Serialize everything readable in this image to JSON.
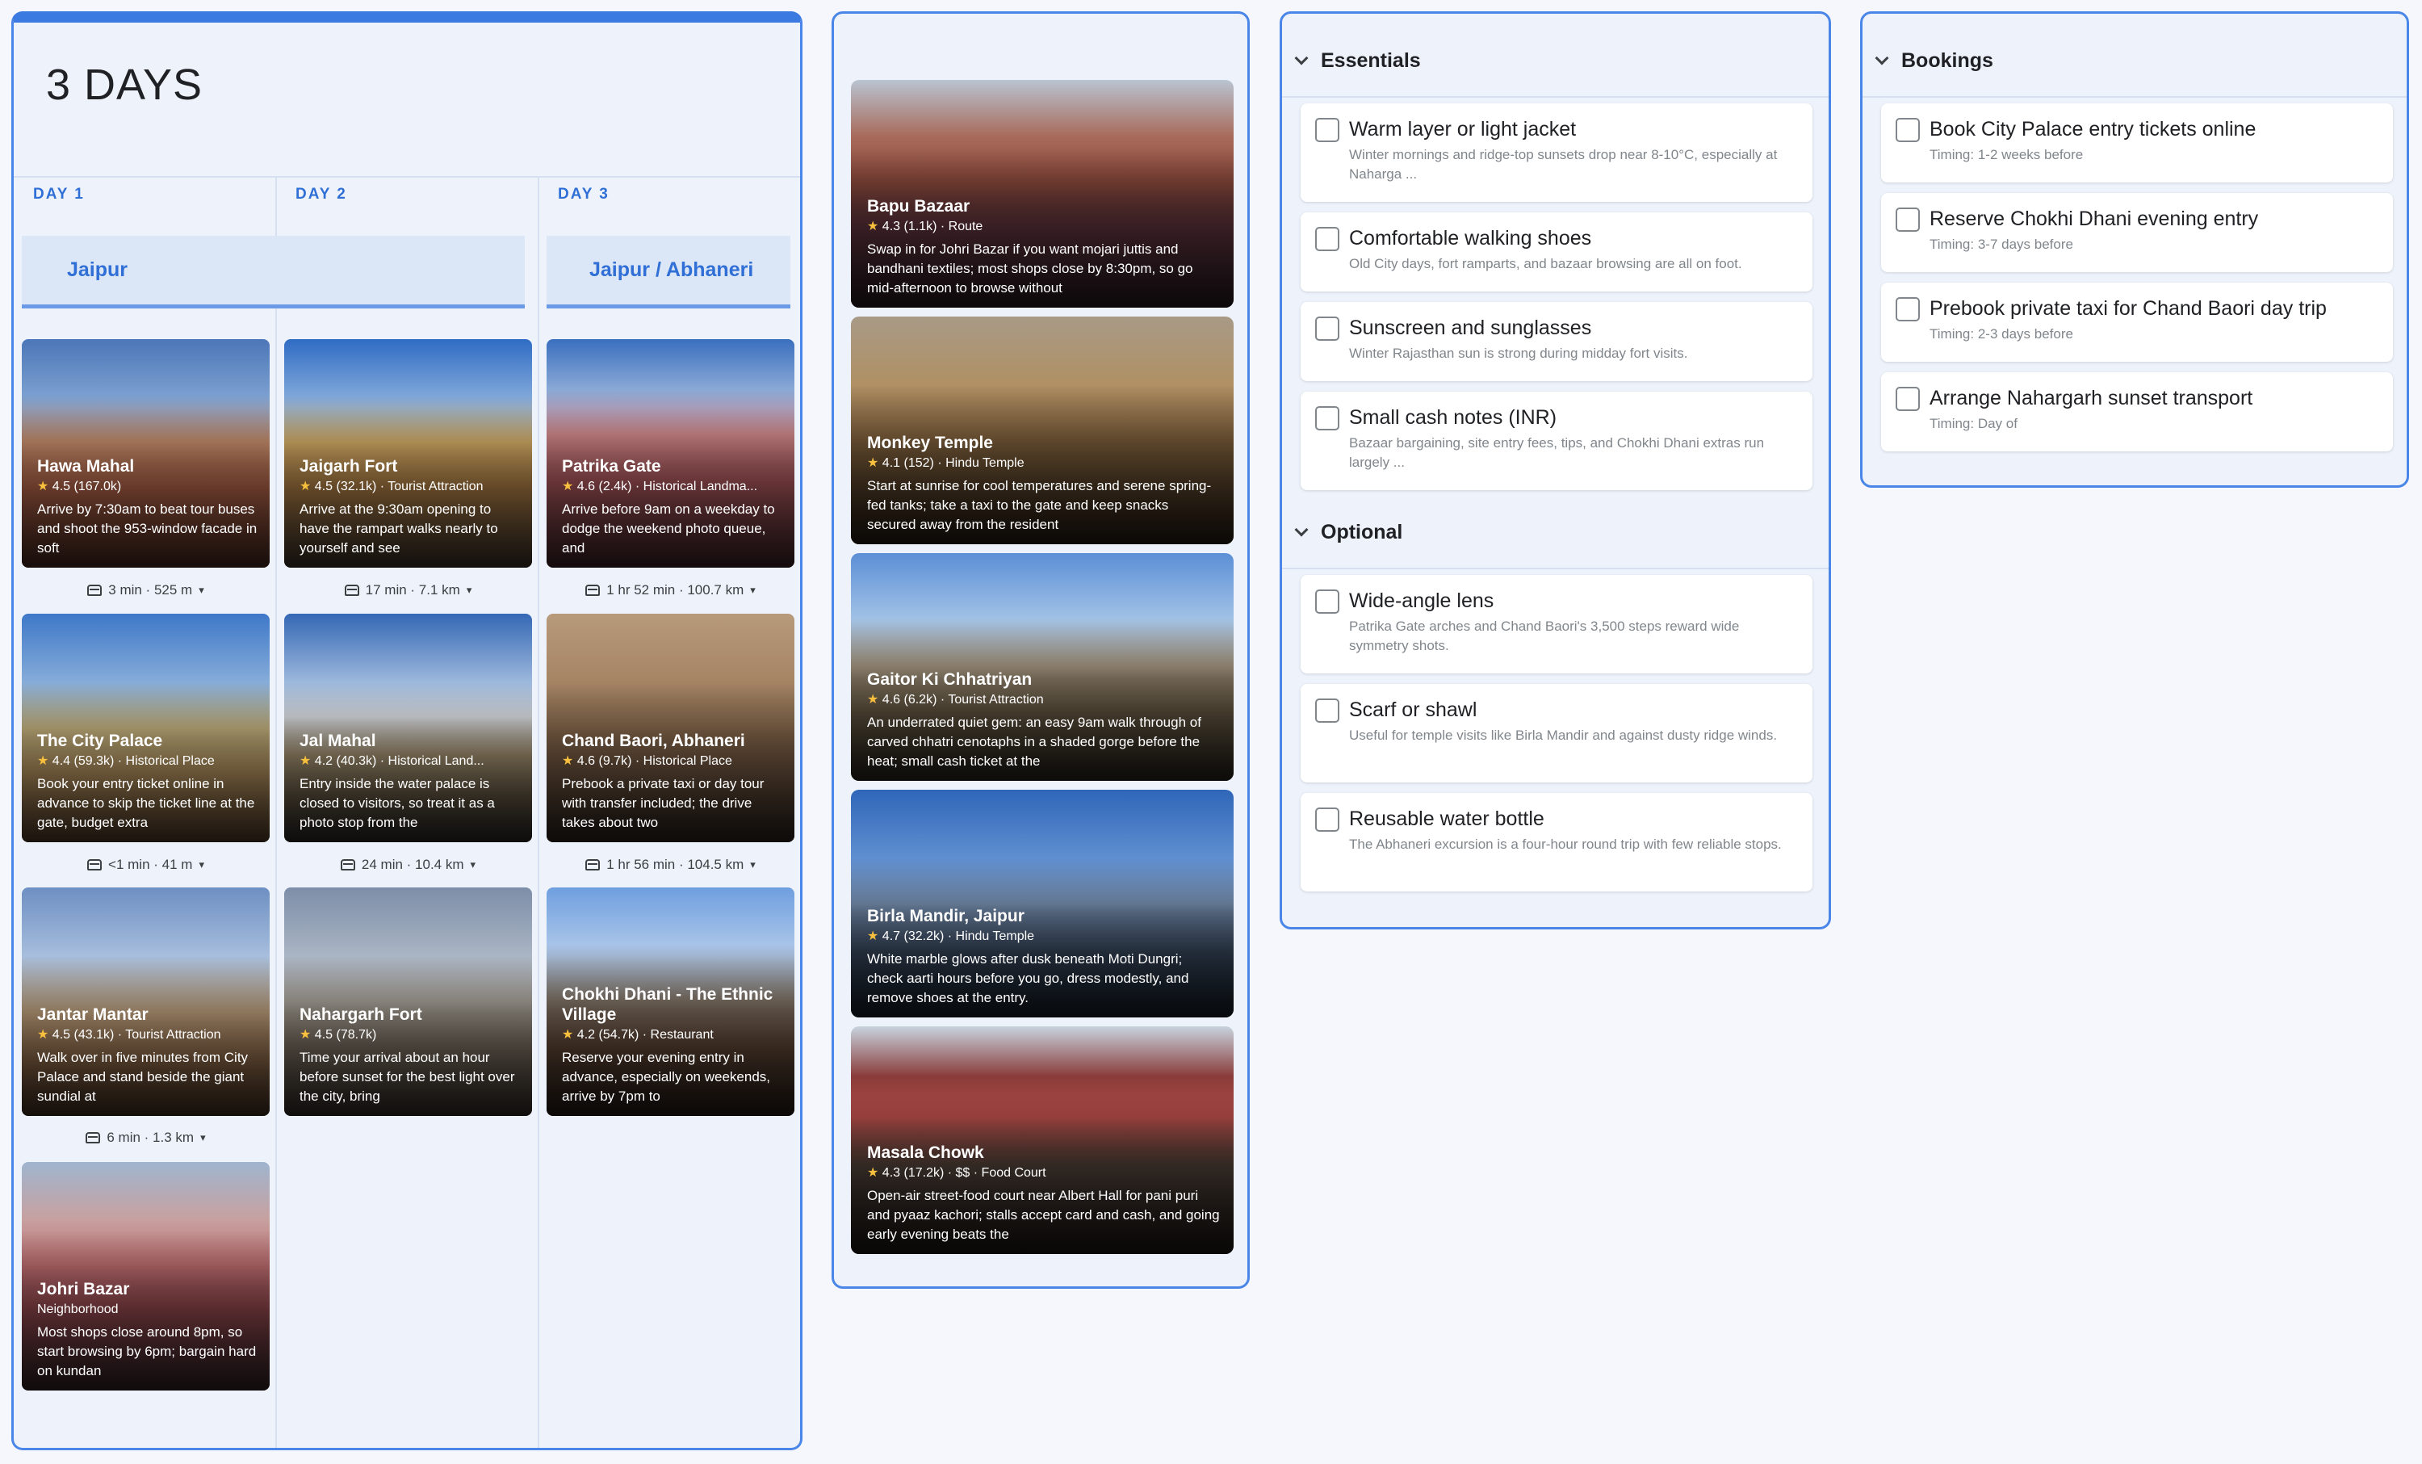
{
  "trip": {
    "title": "3 DAYS",
    "days": [
      {
        "label": "DAY 1",
        "location": "Jaipur"
      },
      {
        "label": "DAY 2",
        "location": ""
      },
      {
        "label": "DAY 3",
        "location": "Jaipur / Abhaneri"
      }
    ],
    "cards": [
      {
        "name": "Hawa Mahal",
        "rating": "4.5",
        "count": "(167.0k)",
        "category": "",
        "desc": "Arrive by 7:30am to beat tour buses and shoot the 953-window facade in soft"
      },
      {
        "name": "The City Palace",
        "rating": "4.4",
        "count": "(59.3k)",
        "category": "· Historical Place",
        "desc": "Book your entry ticket online in advance to skip the ticket line at the gate, budget extra"
      },
      {
        "name": "Jantar Mantar",
        "rating": "4.5",
        "count": "(43.1k)",
        "category": "· Tourist Attraction",
        "desc": "Walk over in five minutes from City Palace and stand beside the giant sundial at"
      },
      {
        "name": "Johri Bazar",
        "rating": "",
        "count": "",
        "category": "Neighborhood",
        "desc": "Most shops close around 8pm, so start browsing by 6pm; bargain hard on kundan"
      },
      {
        "name": "Jaigarh Fort",
        "rating": "4.5",
        "count": "(32.1k)",
        "category": "· Tourist Attraction",
        "desc": "Arrive at the 9:30am opening to have the rampart walks nearly to yourself and see"
      },
      {
        "name": "Jal Mahal",
        "rating": "4.2",
        "count": "(40.3k)",
        "category": "· Historical Land...",
        "desc": "Entry inside the water palace is closed to visitors, so treat it as a photo stop from the"
      },
      {
        "name": "Nahargarh Fort",
        "rating": "4.5",
        "count": "(78.7k)",
        "category": "",
        "desc": "Time your arrival about an hour before sunset for the best light over the city, bring"
      },
      {
        "name": "Patrika Gate",
        "rating": "4.6",
        "count": "(2.4k)",
        "category": "· Historical Landma...",
        "desc": "Arrive before 9am on a weekday to dodge the weekend photo queue, and"
      },
      {
        "name": "Chand Baori, Abhaneri",
        "rating": "4.6",
        "count": "(9.7k)",
        "category": "· Historical Place",
        "desc": "Prebook a private taxi or day tour with transfer included; the drive takes about two"
      },
      {
        "name": "Chokhi Dhani - The Ethnic Village",
        "rating": "4.2",
        "count": "(54.7k)",
        "category": "· Restaurant",
        "desc": "Reserve your evening entry in advance, especially on weekends, arrive by 7pm to"
      }
    ],
    "travel": [
      "3 min · 525 m",
      "<1 min · 41 m",
      "6 min · 1.3 km",
      "17 min · 7.1 km",
      "24 min · 10.4 km",
      "1 hr 52 min · 100.7 km",
      "1 hr 56 min · 104.5 km"
    ]
  },
  "extras": [
    {
      "name": "Bapu Bazaar",
      "rating": "4.3",
      "count": "(1.1k)",
      "category": "· Route",
      "desc": "Swap in for Johri Bazar if you want mojari juttis and bandhani textiles; most shops close by 8:30pm, so go mid-afternoon to browse without"
    },
    {
      "name": "Monkey Temple",
      "rating": "4.1",
      "count": "(152)",
      "category": "· Hindu Temple",
      "desc": "Start at sunrise for cool temperatures and serene spring-fed tanks; take a taxi to the gate and keep snacks secured away from the resident"
    },
    {
      "name": "Gaitor Ki Chhatriyan",
      "rating": "4.6",
      "count": "(6.2k)",
      "category": "· Tourist Attraction",
      "desc": "An underrated quiet gem: an easy 9am walk through of carved chhatri cenotaphs in a shaded gorge before the heat; small cash ticket at the"
    },
    {
      "name": "Birla Mandir, Jaipur",
      "rating": "4.7",
      "count": "(32.2k)",
      "category": "· Hindu Temple",
      "desc": "White marble glows after dusk beneath Moti Dungri; check aarti hours before you go, dress modestly, and remove shoes at the entry."
    },
    {
      "name": "Masala Chowk",
      "rating": "4.3",
      "count": "(17.2k)",
      "category": "· $$ · Food Court",
      "desc": "Open-air street-food court near Albert Hall for pani puri and pyaaz kachori; stalls accept card and cash, and going early evening beats the"
    }
  ],
  "essentials": {
    "title": "Essentials",
    "items": [
      {
        "label": "Warm layer or light jacket",
        "note": "Winter mornings and ridge-top sunsets drop near 8-10°C, especially at Naharga ..."
      },
      {
        "label": "Comfortable walking shoes",
        "note": "Old City days, fort ramparts, and bazaar browsing are all on foot."
      },
      {
        "label": "Sunscreen and sunglasses",
        "note": "Winter Rajasthan sun is strong during midday fort visits."
      },
      {
        "label": "Small cash notes (INR)",
        "note": "Bazaar bargaining, site entry fees, tips, and Chokhi Dhani extras run largely ..."
      }
    ]
  },
  "optional": {
    "title": "Optional",
    "items": [
      {
        "label": "Wide-angle lens",
        "note": "Patrika Gate arches and Chand Baori's 3,500 steps reward wide symmetry shots."
      },
      {
        "label": "Scarf or shawl",
        "note": "Useful for temple visits like Birla Mandir and against dusty ridge winds."
      },
      {
        "label": "Reusable water bottle",
        "note": "The Abhaneri excursion is a four-hour round trip with few reliable stops."
      }
    ]
  },
  "bookings": {
    "title": "Bookings",
    "items": [
      {
        "label": "Book City Palace entry tickets online",
        "note": "Timing: 1-2 weeks before"
      },
      {
        "label": "Reserve Chokhi Dhani evening entry",
        "note": "Timing: 3-7 days before"
      },
      {
        "label": "Prebook private taxi for Chand Baori day trip",
        "note": "Timing: 2-3 days before"
      },
      {
        "label": "Arrange Nahargarh sunset transport",
        "note": "Timing: Day of"
      }
    ]
  },
  "colors": {
    "accent": "#3b7ae0",
    "star": "#f9c03e",
    "panel_bg": "#eef3fb"
  }
}
